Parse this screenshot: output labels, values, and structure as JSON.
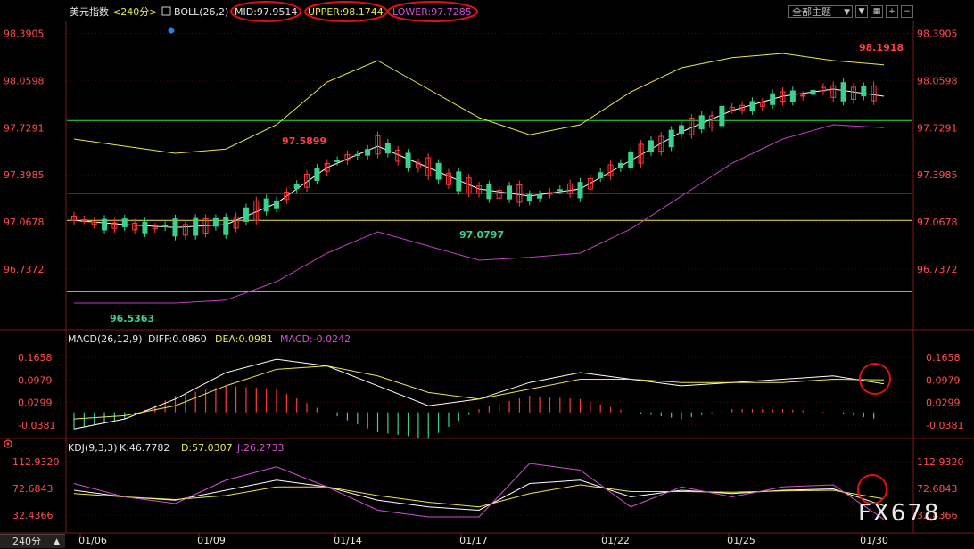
{
  "header": {
    "symbol": "美元指数",
    "period": "<240分>",
    "indicator": "BOLL(26,2)",
    "mid": "MID:97.9514",
    "upper": "UPPER:98.1744",
    "lower": "LOWER:97.7285"
  },
  "toolbar": {
    "theme_select": "全部主题"
  },
  "price_axis_ticks": [
    "98.3905",
    "98.0598",
    "97.7291",
    "97.3985",
    "97.0678",
    "96.7372"
  ],
  "macd_header": {
    "name": "MACD(26,12,9)",
    "diff": "DIFF:0.0860",
    "dea": "DEA:0.0981",
    "macd": "MACD:-0.0242"
  },
  "macd_axis_ticks": [
    "0.1658",
    "0.0979",
    "0.0299",
    "-0.0381"
  ],
  "kdj_header": {
    "name": "KDJ(9,3,3)",
    "k": "K:46.7782",
    "d": "D:57.0307",
    "j": "J:26.2733"
  },
  "kdj_axis_ticks": [
    "112.9320",
    "72.6843",
    "32.4366"
  ],
  "date_labels": [
    "01/06",
    "01/09",
    "01/14",
    "01/17",
    "01/22",
    "01/25",
    "01/30"
  ],
  "annotations": {
    "high": "98.1918",
    "mid_high": "97.5899",
    "mid_low": "97.0797",
    "low": "96.5363"
  },
  "period_tab": "240分",
  "watermark": "FX678",
  "colors": {
    "up": "#ff3b3b",
    "down": "#3ccf8e",
    "mid": "#ffffff",
    "upper": "#e8e84a",
    "lower": "#c040c0",
    "hline_green": "#35e035",
    "hline_yellow": "#e8e84a"
  },
  "chart_data": {
    "type": "candlestick",
    "title": "美元指数 <240分>",
    "categories": [
      "01/06",
      "01/09",
      "01/14",
      "01/17",
      "01/22",
      "01/25",
      "01/30"
    ],
    "horizontal_lines": [
      97.78,
      97.27,
      97.08,
      96.58
    ],
    "price_series": [
      {
        "name": "MID",
        "values": [
          97.08,
          97.05,
          97.03,
          97.05,
          97.2,
          97.45,
          97.6,
          97.45,
          97.3,
          97.25,
          97.3,
          97.5,
          97.7,
          97.85,
          97.95,
          98.0,
          97.95
        ]
      },
      {
        "name": "UPPER",
        "values": [
          97.65,
          97.6,
          97.55,
          97.58,
          97.75,
          98.05,
          98.2,
          98.0,
          97.8,
          97.68,
          97.75,
          97.98,
          98.15,
          98.22,
          98.25,
          98.2,
          98.17
        ]
      },
      {
        "name": "LOWER",
        "values": [
          96.5,
          96.5,
          96.5,
          96.52,
          96.65,
          96.85,
          97.0,
          96.9,
          96.8,
          96.82,
          96.85,
          97.02,
          97.25,
          97.48,
          97.65,
          97.75,
          97.73
        ]
      }
    ],
    "macd": {
      "diff": [
        -0.05,
        -0.02,
        0.04,
        0.12,
        0.16,
        0.14,
        0.08,
        0.02,
        0.04,
        0.09,
        0.12,
        0.1,
        0.08,
        0.09,
        0.1,
        0.11,
        0.086
      ],
      "dea": [
        -0.02,
        -0.01,
        0.02,
        0.08,
        0.13,
        0.14,
        0.11,
        0.06,
        0.04,
        0.07,
        0.1,
        0.1,
        0.09,
        0.09,
        0.09,
        0.1,
        0.098
      ],
      "hist": [
        -0.05,
        -0.02,
        0.05,
        0.08,
        0.07,
        0.0,
        -0.06,
        -0.08,
        0.01,
        0.05,
        0.04,
        0.0,
        -0.02,
        0.01,
        0.01,
        0.0,
        -0.024
      ]
    },
    "kdj": {
      "k": [
        70,
        60,
        55,
        70,
        85,
        75,
        55,
        45,
        40,
        80,
        85,
        60,
        70,
        65,
        70,
        72,
        46.78
      ],
      "d": [
        65,
        60,
        56,
        62,
        75,
        75,
        62,
        52,
        45,
        65,
        78,
        68,
        68,
        67,
        69,
        70,
        57.03
      ],
      "j": [
        80,
        60,
        50,
        85,
        105,
        75,
        40,
        30,
        30,
        110,
        100,
        45,
        75,
        60,
        75,
        78,
        26.27
      ]
    }
  }
}
